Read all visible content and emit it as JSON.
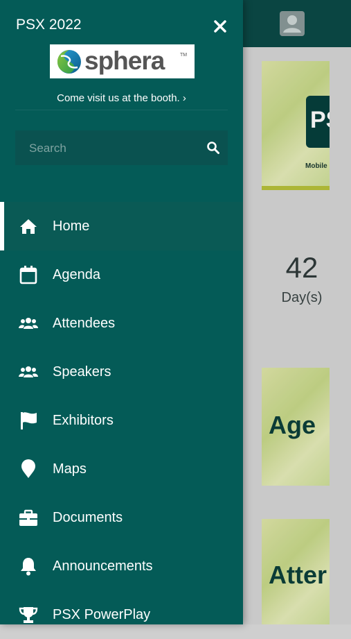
{
  "drawer": {
    "title": "PSX 2022",
    "close_icon": "close-icon",
    "logo_text": "sphera",
    "logo_tm": "TM",
    "booth_link": "Come visit us at the booth. ›",
    "search": {
      "placeholder": "Search",
      "value": ""
    },
    "menu": [
      {
        "label": "Home",
        "icon": "home-icon",
        "active": true
      },
      {
        "label": "Agenda",
        "icon": "calendar-icon",
        "active": false
      },
      {
        "label": "Attendees",
        "icon": "users-icon",
        "active": false
      },
      {
        "label": "Speakers",
        "icon": "users-icon",
        "active": false
      },
      {
        "label": "Exhibitors",
        "icon": "flag-icon",
        "active": false
      },
      {
        "label": "Maps",
        "icon": "map-pin-icon",
        "active": false
      },
      {
        "label": "Documents",
        "icon": "briefcase-icon",
        "active": false
      },
      {
        "label": "Announcements",
        "icon": "bell-icon",
        "active": false
      },
      {
        "label": "PSX PowerPlay",
        "icon": "trophy-icon",
        "active": false
      }
    ]
  },
  "background": {
    "countdown_value": "42",
    "countdown_unit": "Day(s)",
    "card1_badge": "PS",
    "card1_caption": "Mobile",
    "card2_title": "Age",
    "card3_title": "Atter"
  },
  "colors": {
    "drawer": "#045b57",
    "header": "#0b4a47",
    "active_item": "#0a5a55"
  }
}
